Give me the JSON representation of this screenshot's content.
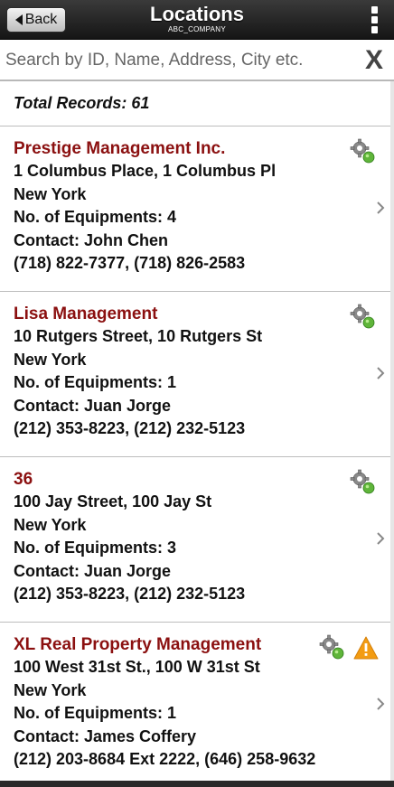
{
  "header": {
    "back_label": "Back",
    "title": "Locations",
    "subtitle": "ABC_COMPANY"
  },
  "search": {
    "placeholder": "Search by ID, Name, Address, City etc.",
    "value": "",
    "clear_label": "X"
  },
  "summary": {
    "total_records": "Total Records: 61"
  },
  "locations": [
    {
      "name": "Prestige Management Inc.",
      "address": "1 Columbus Place, 1 Columbus Pl",
      "city": "New York",
      "equipments": "No. of Equipments: 4",
      "contact": "Contact: John Chen",
      "phones": "(718) 822-7377, (718) 826-2583",
      "icons": [
        "gear-icon"
      ]
    },
    {
      "name": "Lisa Management",
      "address": "10 Rutgers Street, 10 Rutgers St",
      "city": "New York",
      "equipments": "No. of Equipments: 1",
      "contact": "Contact: Juan Jorge",
      "phones": "(212) 353-8223, (212) 232-5123",
      "icons": [
        "gear-icon"
      ]
    },
    {
      "name": "36",
      "address": "100 Jay Street, 100 Jay St",
      "city": "New York",
      "equipments": "No. of Equipments: 3",
      "contact": "Contact: Juan Jorge",
      "phones": "(212) 353-8223, (212) 232-5123",
      "icons": [
        "gear-icon"
      ]
    },
    {
      "name": "XL Real Property Management",
      "address": "100 West 31st St., 100 W 31st St",
      "city": "New York",
      "equipments": "No. of Equipments: 1",
      "contact": "Contact: James Coffery",
      "phones": "(212) 203-8684 Ext 2222, (646) 258-9632",
      "icons": [
        "gear-icon",
        "warning-icon"
      ]
    }
  ],
  "colors": {
    "name_text": "#8b1010",
    "header_bg": "#1e1e1e",
    "gear_badge": "#5fb53a",
    "warning": "#f39c12"
  }
}
